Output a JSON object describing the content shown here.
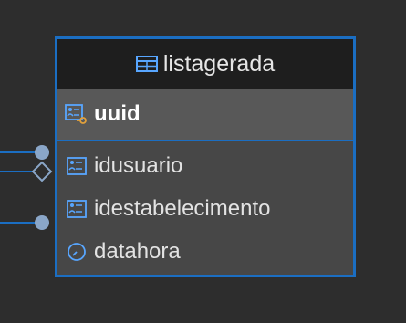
{
  "entity": {
    "title": "listagerada",
    "header_icon": "table-icon",
    "primary_key": {
      "label": "uuid",
      "icon": "key-field-icon"
    },
    "columns": [
      {
        "label": "idusuario",
        "icon": "field-icon"
      },
      {
        "label": "idestabelecimento",
        "icon": "field-icon"
      },
      {
        "label": "datahora",
        "icon": "clock-icon"
      }
    ]
  },
  "colors": {
    "canvas": "#2d2d2d",
    "accent": "#1b6ec2",
    "header_bg": "#1e1e1e",
    "body_bg": "#474747",
    "pk_bg": "#585858",
    "connector_node": "#8aa6c8",
    "key_badge": "#e0a03c"
  }
}
